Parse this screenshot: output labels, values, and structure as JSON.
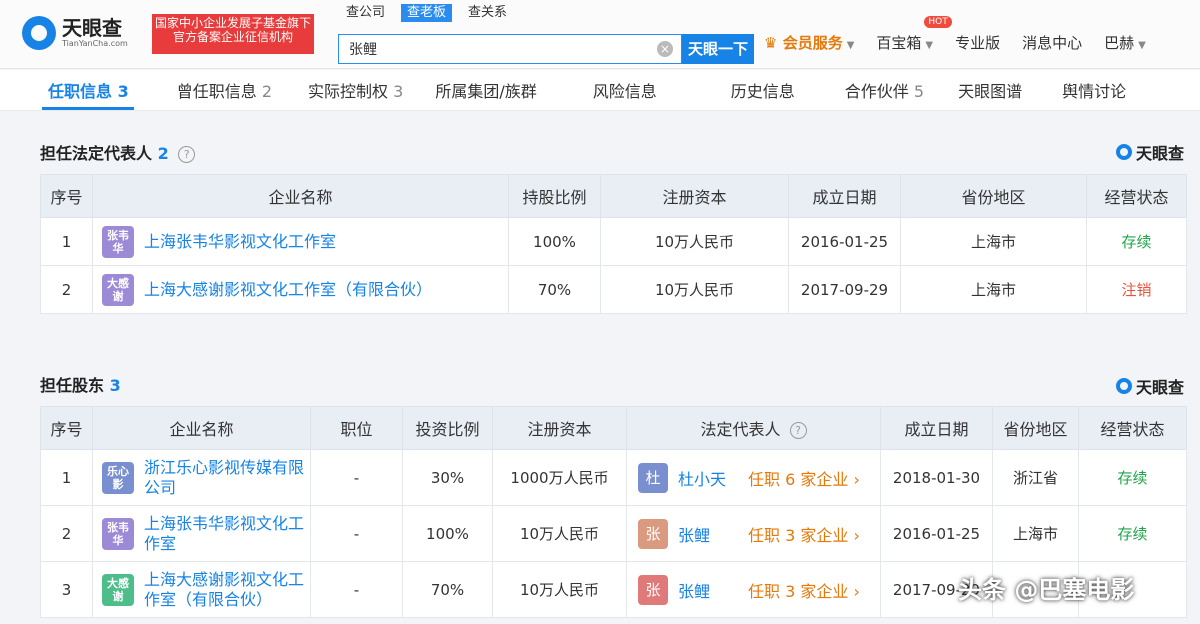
{
  "header": {
    "logo_text": "天眼查",
    "logo_sub": "TianYanCha.com",
    "banner_text": "国家中小企业发展子基金旗下官方备案企业征信机构",
    "search_tabs": [
      "查公司",
      "查老板",
      "查关系"
    ],
    "search_value": "张鲤",
    "search_button": "天眼一下",
    "nav": {
      "vip": "会员服务",
      "treasure": "百宝箱",
      "hot_badge": "HOT",
      "pro": "专业版",
      "messages": "消息中心",
      "user": "巴赫"
    }
  },
  "tabs": [
    {
      "label": "任职信息",
      "count": "3",
      "active": true
    },
    {
      "label": "曾任职信息",
      "count": "2"
    },
    {
      "label": "实际控制权",
      "count": "3"
    },
    {
      "label": "所属集团/族群",
      "count": ""
    },
    {
      "label": "风险信息",
      "count": ""
    },
    {
      "label": "历史信息",
      "count": ""
    },
    {
      "label": "合作伙伴",
      "count": "5"
    },
    {
      "label": "天眼图谱",
      "count": ""
    },
    {
      "label": "舆情讨论",
      "count": ""
    }
  ],
  "legal_rep": {
    "title": "担任法定代表人",
    "count": "2",
    "brand": "天眼查",
    "columns": [
      "序号",
      "企业名称",
      "持股比例",
      "注册资本",
      "成立日期",
      "省份地区",
      "经营状态"
    ],
    "rows": [
      {
        "no": "1",
        "logo": "张韦华",
        "logo_color": "#9c8ad6",
        "name": "上海张韦华影视文化工作室",
        "share": "100%",
        "capital": "10万人民币",
        "date": "2016-01-25",
        "region": "上海市",
        "status": "存续",
        "status_type": "ok"
      },
      {
        "no": "2",
        "logo": "大感谢",
        "logo_color": "#9c8ad6",
        "name": "上海大感谢影视文化工作室（有限合伙）",
        "share": "70%",
        "capital": "10万人民币",
        "date": "2017-09-29",
        "region": "上海市",
        "status": "注销",
        "status_type": "bad"
      }
    ]
  },
  "shareholder": {
    "title": "担任股东",
    "count": "3",
    "brand": "天眼查",
    "columns": [
      "序号",
      "企业名称",
      "职位",
      "投资比例",
      "注册资本",
      "法定代表人",
      "成立日期",
      "省份地区",
      "经营状态"
    ],
    "rows": [
      {
        "no": "1",
        "logo": "乐心影",
        "logo_color": "#7a8fd0",
        "name": "浙江乐心影视传媒有限公司",
        "position": "-",
        "ratio": "30%",
        "capital": "1000万人民币",
        "rep_avatar": "杜",
        "rep_color": "#7a8fd0",
        "rep_name": "杜小天",
        "rep_role": "任职 6 家企业 ›",
        "date": "2018-01-30",
        "region": "浙江省",
        "status": "存续",
        "status_type": "ok"
      },
      {
        "no": "2",
        "logo": "张韦华",
        "logo_color": "#9c8ad6",
        "name": "上海张韦华影视文化工作室",
        "position": "-",
        "ratio": "100%",
        "capital": "10万人民币",
        "rep_avatar": "张",
        "rep_color": "#d99a80",
        "rep_name": "张鲤",
        "rep_role": "任职 3 家企业 ›",
        "date": "2016-01-25",
        "region": "上海市",
        "status": "存续",
        "status_type": "ok"
      },
      {
        "no": "3",
        "logo": "大感谢",
        "logo_color": "#4dbd8a",
        "name": "上海大感谢影视文化工作室（有限合伙）",
        "position": "-",
        "ratio": "70%",
        "capital": "10万人民币",
        "rep_avatar": "张",
        "rep_color": "#e07a7a",
        "rep_name": "张鲤",
        "rep_role": "任职 3 家企业 ›",
        "date": "2017-09-29",
        "region": "",
        "status": "",
        "status_type": ""
      }
    ]
  },
  "watermark": "头条 @巴塞电影"
}
